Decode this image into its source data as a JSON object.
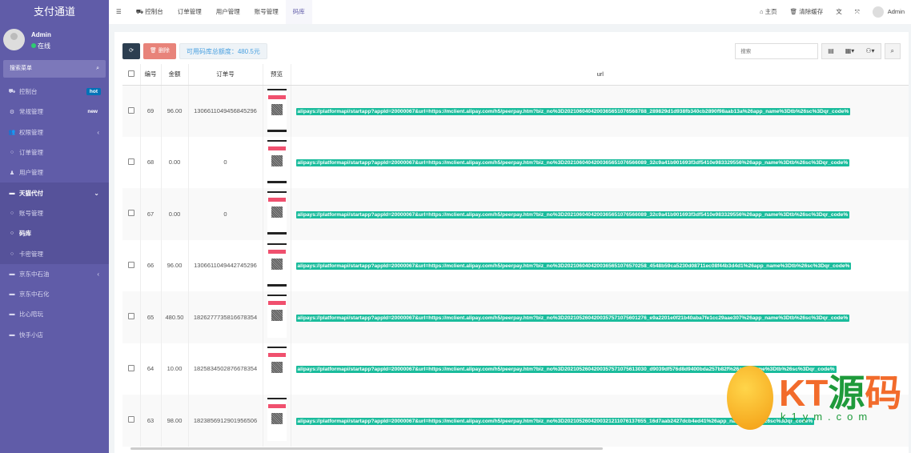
{
  "app": {
    "title": "支付通道"
  },
  "user": {
    "name": "Admin",
    "status": "在线"
  },
  "sidebar": {
    "search_label": "搜索菜单",
    "items": [
      {
        "label": "控制台",
        "icon": "dashboard-icon",
        "badge": "hot",
        "badge_color": "#0073b7"
      },
      {
        "label": "常规管理",
        "icon": "cogs-icon",
        "badge": "new"
      },
      {
        "label": "权限管理",
        "icon": "group-icon",
        "chevron": "‹"
      },
      {
        "label": "订单管理",
        "icon": "circle-icon"
      },
      {
        "label": "用户管理",
        "icon": "user-icon"
      },
      {
        "label": "天猫代付",
        "icon": "list-icon",
        "chevron": "⌄"
      },
      {
        "label": "账号管理",
        "icon": "circle-icon"
      },
      {
        "label": "码库",
        "icon": "circle-icon"
      },
      {
        "label": "卡密管理",
        "icon": "circle-icon"
      },
      {
        "label": "京东中石油",
        "icon": "list-icon",
        "chevron": "‹"
      },
      {
        "label": "京东中石化",
        "icon": "list-icon"
      },
      {
        "label": "比心陪玩",
        "icon": "list-icon"
      },
      {
        "label": "快手小店",
        "icon": "list-icon"
      }
    ]
  },
  "topbar": {
    "tabs": [
      "控制台",
      "订单管理",
      "用户管理",
      "账号管理",
      "码库"
    ],
    "active_tab": "码库",
    "home": "主页",
    "clear_cache": "清除缓存",
    "admin": "Admin"
  },
  "toolbar": {
    "delete": "删除",
    "balance": "可用码库总额度：480.5元",
    "search_placeholder": "搜索"
  },
  "table": {
    "columns": [
      "编号",
      "金额",
      "订单号",
      "预览",
      "url"
    ],
    "rows": [
      {
        "id": "69",
        "amount": "96.00",
        "order": "1306611049456845296",
        "url": "alipays://platformapi/startapp?appId=20000067&url=https://mclient.alipay.com/h5/peerpay.htm?biz_no%3D2021060404200365651076568788_289829d1d938fb340cb2890f98aab13a%26app_name%3Dtb%26sc%3Dqr_code%"
      },
      {
        "id": "68",
        "amount": "0.00",
        "order": "0",
        "url": "alipays://platformapi/startapp?appId=20000067&url=https://mclient.alipay.com/h5/peerpay.htm?biz_no%3D2021060404200365651076566089_32c9a41b901693f3df5410e983329556%26app_name%3Dtb%26sc%3Dqr_code%"
      },
      {
        "id": "67",
        "amount": "0.00",
        "order": "0",
        "url": "alipays://platformapi/startapp?appId=20000067&url=https://mclient.alipay.com/h5/peerpay.htm?biz_no%3D2021060404200365651076566089_32c9a41b901693f3df5410e983329556%26app_name%3Dtb%26sc%3Dqr_code%"
      },
      {
        "id": "66",
        "amount": "96.00",
        "order": "1306611049442745296",
        "url": "alipays://platformapi/startapp?appId=20000067&url=https://mclient.alipay.com/h5/peerpay.htm?biz_no%3D2021060404200365651076570258_4548b59ca5230d08711ec08f44b3d4d1%26app_name%3Dtb%26sc%3Dqr_code%"
      },
      {
        "id": "65",
        "amount": "480.50",
        "order": "1826277735816678354",
        "url": "alipays://platformapi/startapp?appId=20000067&url=https://mclient.alipay.com/h5/peerpay.htm?biz_no%3D2021052604200357571075601276_e9a2201e0f21b40aba7fe1cc29aae307%26app_name%3Dtb%26sc%3Dqr_code%"
      },
      {
        "id": "64",
        "amount": "10.00",
        "order": "1825834502876678354",
        "url": "alipays://platformapi/startapp?appId=20000067&url=https://mclient.alipay.com/h5/peerpay.htm?biz_no%3D2021052604200357571075613030_d9039df576d8d9400bda257b82f%26app_name%3Dtb%26sc%3Dqr_code%"
      },
      {
        "id": "63",
        "amount": "98.00",
        "order": "1823856912901956506",
        "url": "alipays://platformapi/startapp?appId=20000067&url=https://mclient.alipay.com/h5/peerpay.htm?biz_no%3D2021052604200321211076137655_16d7aab2427dcb4ed41%26app_name%3Dtb%26sc%3Dqr_code%"
      }
    ]
  },
  "watermark": {
    "text": "KT源码",
    "site": "k1ym.com"
  },
  "colors": {
    "sidebar": "#605ca8",
    "url_badge": "#1abc9c",
    "delete": "#e8837a",
    "dark": "#2c3e50"
  }
}
